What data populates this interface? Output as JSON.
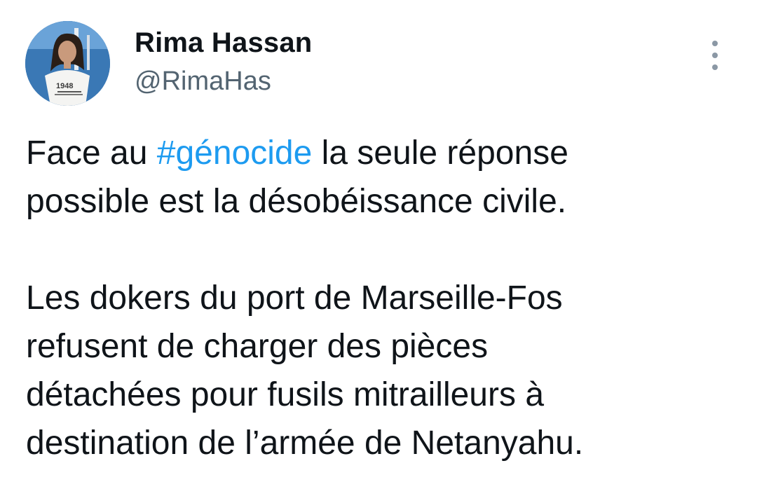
{
  "author": {
    "display_name": "Rima Hassan",
    "handle": "@RimaHas",
    "avatar_shirt_text": "1948"
  },
  "menu": {
    "icon": "more-vertical-icon"
  },
  "tweet": {
    "line1_before": "Face au ",
    "hashtag": "#génocide",
    "line1_after": " la seule réponse",
    "line2": "possible est la désobéissance civile.",
    "line3": "Les dokers du port de Marseille-Fos",
    "line4": "refusent de charger des pièces",
    "line5": "détachées pour fusils mitrailleurs à",
    "line6": "destination de l’armée de Netanyahu."
  },
  "colors": {
    "text": "#0f1419",
    "secondary": "#536471",
    "hashtag": "#1d9bf0"
  }
}
